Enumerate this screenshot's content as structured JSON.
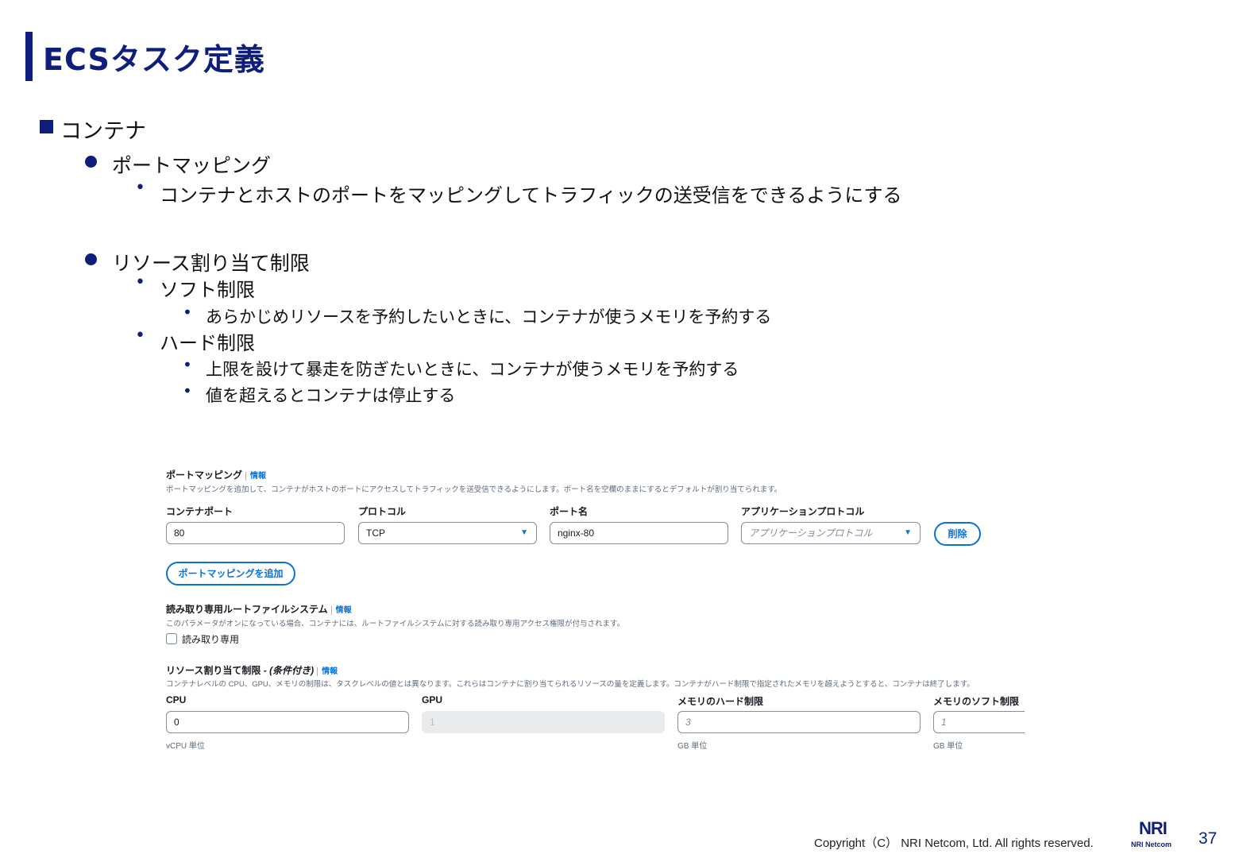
{
  "slide": {
    "title": "ECSタスク定義",
    "page_number": "37",
    "copyright": "Copyright（C） NRI Netcom, Ltd. All rights reserved.",
    "logo_mark": "NRI",
    "logo_text": "NRI Netcom"
  },
  "outline": {
    "heading": "コンテナ",
    "port": {
      "label": "ポートマッピング",
      "desc": "コンテナとホストのポートをマッピングしてトラフィックの送受信をできるようにする"
    },
    "resource": {
      "label": "リソース割り当て制限",
      "soft": {
        "label": "ソフト制限",
        "desc": "あらかじめリソースを予約したいときに、コンテナが使うメモリを予約する"
      },
      "hard": {
        "label": "ハード制限",
        "desc1": "上限を設けて暴走を防ぎたいときに、コンテナが使うメモリを予約する",
        "desc2": "値を超えるとコンテナは停止する"
      }
    }
  },
  "console": {
    "port_mapping": {
      "title": "ポートマッピング",
      "info": "情報",
      "desc": "ポートマッピングを追加して、コンテナがホストのポートにアクセスしてトラフィックを送受信できるようにします。ポート名を空欄のままにするとデフォルトが割り当てられます。",
      "container_port_label": "コンテナポート",
      "container_port_value": "80",
      "protocol_label": "プロトコル",
      "protocol_value": "TCP",
      "port_name_label": "ポート名",
      "port_name_value": "nginx-80",
      "app_protocol_label": "アプリケーションプロトコル",
      "app_protocol_placeholder": "アプリケーションプロトコル",
      "delete_label": "削除",
      "add_label": "ポートマッピングを追加"
    },
    "readonly": {
      "title": "読み取り専用ルートファイルシステム",
      "info": "情報",
      "desc": "このパラメータがオンになっている場合、コンテナには、ルートファイルシステムに対する読み取り専用アクセス権限が付与されます。",
      "checkbox_label": "読み取り専用"
    },
    "resource_limits": {
      "title": "リソース割り当て制限 - ",
      "title_suffix": "(条件付き)",
      "info": "情報",
      "desc": "コンテナレベルの CPU、GPU、メモリの制限は、タスクレベルの値とは異なります。これらはコンテナに割り当てられるリソースの量を定義します。コンテナがハード制限で指定されたメモリを超えようとすると、コンテナは終了します。",
      "cpu_label": "CPU",
      "cpu_value": "0",
      "cpu_unit": "vCPU 単位",
      "gpu_label": "GPU",
      "gpu_placeholder": "1",
      "hard_label": "メモリのハード制限",
      "hard_placeholder": "3",
      "hard_unit": "GB 単位",
      "soft_label": "メモリのソフト制限",
      "soft_placeholder": "1",
      "soft_unit": "GB 単位"
    }
  }
}
